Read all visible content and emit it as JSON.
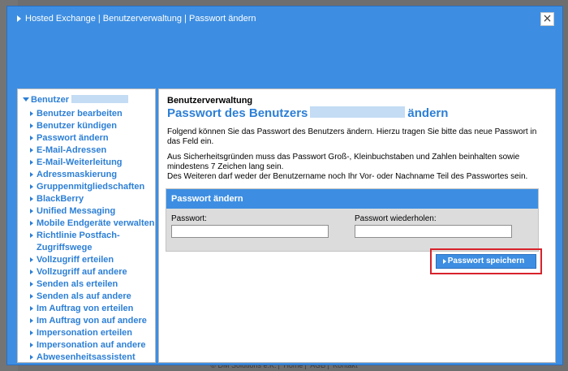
{
  "footer": {
    "company": "© DM Solutions e.K.",
    "links": [
      "Home",
      "AGB",
      "Kontakt"
    ]
  },
  "modal": {
    "title": "Hosted Exchange | Benutzerverwaltung | Passwort ändern",
    "close_label": "×"
  },
  "sidebar": {
    "user_label": "Benutzer",
    "items": [
      "Benutzer bearbeiten",
      "Benutzer kündigen",
      "Passwort ändern",
      "E-Mail-Adressen",
      "E-Mail-Weiterleitung",
      "Adressmaskierung",
      "Gruppenmitgliedschaften",
      "BlackBerry",
      "Unified Messaging",
      "Mobile Endgeräte verwalten",
      "Richtlinie Postfach-Zugriffswege",
      "Vollzugriff erteilen",
      "Vollzugriff auf andere",
      "Senden als erteilen",
      "Senden als auf andere",
      "Im Auftrag von erteilen",
      "Im Auftrag von auf andere",
      "Impersonation erteilen",
      "Impersonation auf andere",
      "Abwesenheitsassistent"
    ]
  },
  "content": {
    "section": "Benutzerverwaltung",
    "title_prefix": "Passwort des Benutzers",
    "title_suffix": "ändern",
    "intro": "Folgend können Sie das Passwort des Benutzers ändern. Hierzu tragen Sie bitte das neue Passwort in das Feld ein.",
    "rules_1": "Aus Sicherheitsgründen muss das Passwort Groß-, Kleinbuchstaben und Zahlen beinhalten sowie mindestens 7 Zeichen lang sein.",
    "rules_2": "Des Weiteren darf weder der Benutzername noch Ihr Vor- oder Nachname Teil des Passwortes sein.",
    "form": {
      "header": "Passwort ändern",
      "password_label": "Passwort:",
      "password_value": "",
      "repeat_label": "Passwort wiederholen:",
      "repeat_value": ""
    },
    "save_label": "Passwort speichern"
  }
}
